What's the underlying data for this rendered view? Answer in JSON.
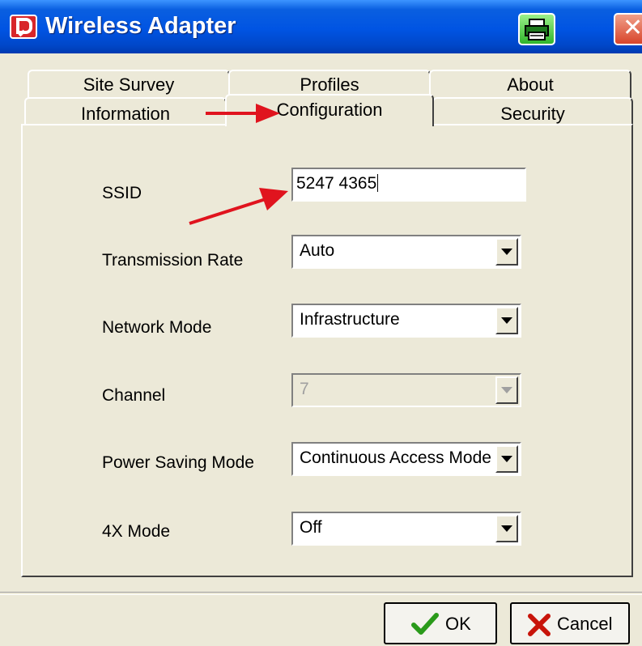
{
  "window": {
    "title": "Wireless Adapter",
    "close_glyph": "✕"
  },
  "tabs": {
    "back_row": [
      "Site Survey",
      "Profiles",
      "About"
    ],
    "front_row": [
      "Information",
      "Configuration",
      "Security"
    ],
    "active": "Configuration"
  },
  "config": {
    "ssid_label": "SSID",
    "ssid_value": "5247 4365",
    "rate_label": "Transmission Rate",
    "rate_value": "Auto",
    "network_mode_label": "Network Mode",
    "network_mode_value": "Infrastructure",
    "channel_label": "Channel",
    "channel_value": "7",
    "power_label": "Power Saving Mode",
    "power_value": "Continuous Access Mode",
    "fourx_label": "4X Mode",
    "fourx_value": "Off"
  },
  "buttons": {
    "ok_label": "OK",
    "cancel_label": "Cancel"
  },
  "colors": {
    "titlebar": "#0054e3",
    "face": "#ece9d8",
    "annotation": "#e0141e"
  },
  "icons": {
    "app": "app-logo-icon",
    "printer": "printer-icon",
    "close": "close-icon",
    "ok": "checkmark-icon",
    "cancel": "x-icon",
    "dropdown": "dropdown-arrow-icon"
  }
}
